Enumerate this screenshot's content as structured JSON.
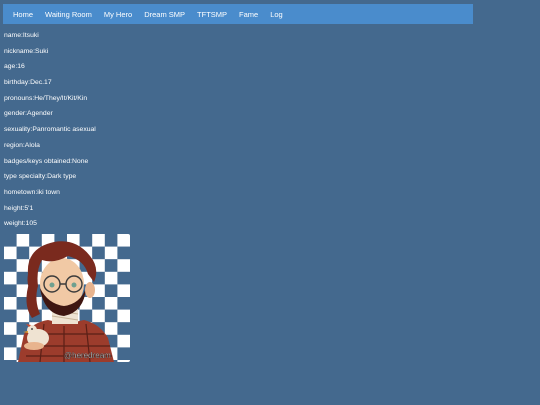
{
  "nav": {
    "items": [
      {
        "label": "Home"
      },
      {
        "label": "Waiting Room"
      },
      {
        "label": "My Hero"
      },
      {
        "label": "Dream SMP"
      },
      {
        "label": "TFTSMP"
      },
      {
        "label": "Fame"
      },
      {
        "label": "Log"
      }
    ]
  },
  "profile": {
    "name": "name:Itsuki",
    "nickname": "nickname:Suki",
    "age": "age:16",
    "birthday": "birthday:Dec.17",
    "pronouns": "pronouns:He/They/It/Kit/Kin",
    "gender": "gender:Agender",
    "sexuality": "sexuality:Panromantic asexual",
    "region": "region:Alola",
    "badges": "badges/keys obtained:None",
    "type_specialty": "type specialty:Dark type",
    "hometown": "hometown:iki town",
    "height": "height:5'1",
    "weight": "weight:105"
  },
  "avatar": {
    "watermark": "@heredream",
    "colors": {
      "checker_dark": "#44698e",
      "checker_light": "#ffffff",
      "hair": "#7a2a1e",
      "skin": "#f1c9a5",
      "shirt": "#9c3c2c"
    }
  },
  "colors": {
    "background": "#44698e",
    "navbar": "#4a8ccc",
    "text": "#ffffff"
  }
}
